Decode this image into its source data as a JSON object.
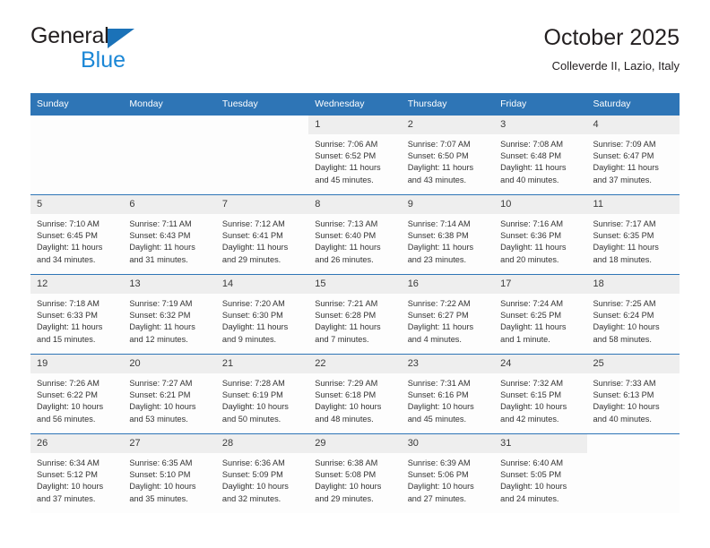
{
  "brand": {
    "name_top": "General",
    "name_bottom": "Blue",
    "color_dark": "#231f20",
    "color_blue": "#1B87D6",
    "triangle_color": "#1B72B8"
  },
  "header": {
    "title": "October 2025",
    "subtitle": "Colleverde II, Lazio, Italy"
  },
  "theme": {
    "header_blue": "#2E75B6",
    "daynum_gray": "#eeeeee",
    "cell_bg": "#fdfdfd",
    "text": "#333333"
  },
  "calendar": {
    "weekday_headers": [
      "Sunday",
      "Monday",
      "Tuesday",
      "Wednesday",
      "Thursday",
      "Friday",
      "Saturday"
    ],
    "weeks": [
      [
        {
          "day": "",
          "blank": true,
          "sunrise": "",
          "sunset": "",
          "daylight": ""
        },
        {
          "day": "",
          "blank": true,
          "sunrise": "",
          "sunset": "",
          "daylight": ""
        },
        {
          "day": "",
          "blank": true,
          "sunrise": "",
          "sunset": "",
          "daylight": ""
        },
        {
          "day": "1",
          "blank": false,
          "sunrise": "Sunrise: 7:06 AM",
          "sunset": "Sunset: 6:52 PM",
          "daylight": "Daylight: 11 hours and 45 minutes."
        },
        {
          "day": "2",
          "blank": false,
          "sunrise": "Sunrise: 7:07 AM",
          "sunset": "Sunset: 6:50 PM",
          "daylight": "Daylight: 11 hours and 43 minutes."
        },
        {
          "day": "3",
          "blank": false,
          "sunrise": "Sunrise: 7:08 AM",
          "sunset": "Sunset: 6:48 PM",
          "daylight": "Daylight: 11 hours and 40 minutes."
        },
        {
          "day": "4",
          "blank": false,
          "sunrise": "Sunrise: 7:09 AM",
          "sunset": "Sunset: 6:47 PM",
          "daylight": "Daylight: 11 hours and 37 minutes."
        }
      ],
      [
        {
          "day": "5",
          "blank": false,
          "sunrise": "Sunrise: 7:10 AM",
          "sunset": "Sunset: 6:45 PM",
          "daylight": "Daylight: 11 hours and 34 minutes."
        },
        {
          "day": "6",
          "blank": false,
          "sunrise": "Sunrise: 7:11 AM",
          "sunset": "Sunset: 6:43 PM",
          "daylight": "Daylight: 11 hours and 31 minutes."
        },
        {
          "day": "7",
          "blank": false,
          "sunrise": "Sunrise: 7:12 AM",
          "sunset": "Sunset: 6:41 PM",
          "daylight": "Daylight: 11 hours and 29 minutes."
        },
        {
          "day": "8",
          "blank": false,
          "sunrise": "Sunrise: 7:13 AM",
          "sunset": "Sunset: 6:40 PM",
          "daylight": "Daylight: 11 hours and 26 minutes."
        },
        {
          "day": "9",
          "blank": false,
          "sunrise": "Sunrise: 7:14 AM",
          "sunset": "Sunset: 6:38 PM",
          "daylight": "Daylight: 11 hours and 23 minutes."
        },
        {
          "day": "10",
          "blank": false,
          "sunrise": "Sunrise: 7:16 AM",
          "sunset": "Sunset: 6:36 PM",
          "daylight": "Daylight: 11 hours and 20 minutes."
        },
        {
          "day": "11",
          "blank": false,
          "sunrise": "Sunrise: 7:17 AM",
          "sunset": "Sunset: 6:35 PM",
          "daylight": "Daylight: 11 hours and 18 minutes."
        }
      ],
      [
        {
          "day": "12",
          "blank": false,
          "sunrise": "Sunrise: 7:18 AM",
          "sunset": "Sunset: 6:33 PM",
          "daylight": "Daylight: 11 hours and 15 minutes."
        },
        {
          "day": "13",
          "blank": false,
          "sunrise": "Sunrise: 7:19 AM",
          "sunset": "Sunset: 6:32 PM",
          "daylight": "Daylight: 11 hours and 12 minutes."
        },
        {
          "day": "14",
          "blank": false,
          "sunrise": "Sunrise: 7:20 AM",
          "sunset": "Sunset: 6:30 PM",
          "daylight": "Daylight: 11 hours and 9 minutes."
        },
        {
          "day": "15",
          "blank": false,
          "sunrise": "Sunrise: 7:21 AM",
          "sunset": "Sunset: 6:28 PM",
          "daylight": "Daylight: 11 hours and 7 minutes."
        },
        {
          "day": "16",
          "blank": false,
          "sunrise": "Sunrise: 7:22 AM",
          "sunset": "Sunset: 6:27 PM",
          "daylight": "Daylight: 11 hours and 4 minutes."
        },
        {
          "day": "17",
          "blank": false,
          "sunrise": "Sunrise: 7:24 AM",
          "sunset": "Sunset: 6:25 PM",
          "daylight": "Daylight: 11 hours and 1 minute."
        },
        {
          "day": "18",
          "blank": false,
          "sunrise": "Sunrise: 7:25 AM",
          "sunset": "Sunset: 6:24 PM",
          "daylight": "Daylight: 10 hours and 58 minutes."
        }
      ],
      [
        {
          "day": "19",
          "blank": false,
          "sunrise": "Sunrise: 7:26 AM",
          "sunset": "Sunset: 6:22 PM",
          "daylight": "Daylight: 10 hours and 56 minutes."
        },
        {
          "day": "20",
          "blank": false,
          "sunrise": "Sunrise: 7:27 AM",
          "sunset": "Sunset: 6:21 PM",
          "daylight": "Daylight: 10 hours and 53 minutes."
        },
        {
          "day": "21",
          "blank": false,
          "sunrise": "Sunrise: 7:28 AM",
          "sunset": "Sunset: 6:19 PM",
          "daylight": "Daylight: 10 hours and 50 minutes."
        },
        {
          "day": "22",
          "blank": false,
          "sunrise": "Sunrise: 7:29 AM",
          "sunset": "Sunset: 6:18 PM",
          "daylight": "Daylight: 10 hours and 48 minutes."
        },
        {
          "day": "23",
          "blank": false,
          "sunrise": "Sunrise: 7:31 AM",
          "sunset": "Sunset: 6:16 PM",
          "daylight": "Daylight: 10 hours and 45 minutes."
        },
        {
          "day": "24",
          "blank": false,
          "sunrise": "Sunrise: 7:32 AM",
          "sunset": "Sunset: 6:15 PM",
          "daylight": "Daylight: 10 hours and 42 minutes."
        },
        {
          "day": "25",
          "blank": false,
          "sunrise": "Sunrise: 7:33 AM",
          "sunset": "Sunset: 6:13 PM",
          "daylight": "Daylight: 10 hours and 40 minutes."
        }
      ],
      [
        {
          "day": "26",
          "blank": false,
          "sunrise": "Sunrise: 6:34 AM",
          "sunset": "Sunset: 5:12 PM",
          "daylight": "Daylight: 10 hours and 37 minutes."
        },
        {
          "day": "27",
          "blank": false,
          "sunrise": "Sunrise: 6:35 AM",
          "sunset": "Sunset: 5:10 PM",
          "daylight": "Daylight: 10 hours and 35 minutes."
        },
        {
          "day": "28",
          "blank": false,
          "sunrise": "Sunrise: 6:36 AM",
          "sunset": "Sunset: 5:09 PM",
          "daylight": "Daylight: 10 hours and 32 minutes."
        },
        {
          "day": "29",
          "blank": false,
          "sunrise": "Sunrise: 6:38 AM",
          "sunset": "Sunset: 5:08 PM",
          "daylight": "Daylight: 10 hours and 29 minutes."
        },
        {
          "day": "30",
          "blank": false,
          "sunrise": "Sunrise: 6:39 AM",
          "sunset": "Sunset: 5:06 PM",
          "daylight": "Daylight: 10 hours and 27 minutes."
        },
        {
          "day": "31",
          "blank": false,
          "sunrise": "Sunrise: 6:40 AM",
          "sunset": "Sunset: 5:05 PM",
          "daylight": "Daylight: 10 hours and 24 minutes."
        },
        {
          "day": "",
          "blank": true,
          "sunrise": "",
          "sunset": "",
          "daylight": ""
        }
      ]
    ]
  }
}
